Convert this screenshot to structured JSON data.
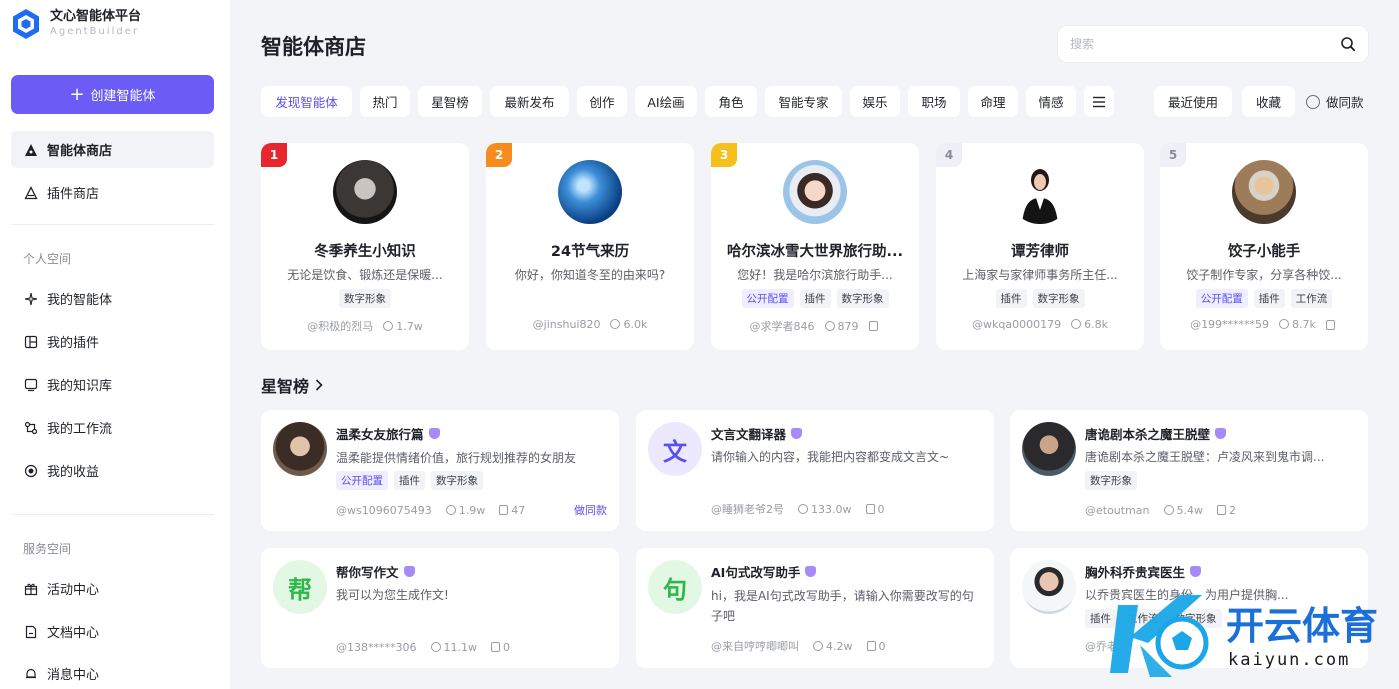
{
  "brand": {
    "title": "文心智能体平台",
    "subtitle": "AgentBuilder"
  },
  "sidebar": {
    "create_label": "创建智能体",
    "main_items": [
      {
        "label": "智能体商店",
        "icon": "agent-store-icon"
      },
      {
        "label": "插件商店",
        "icon": "plugin-store-icon"
      }
    ],
    "personal_title": "个人空间",
    "personal_items": [
      {
        "label": "我的智能体",
        "icon": "sparkle-icon"
      },
      {
        "label": "我的插件",
        "icon": "plugin-icon"
      },
      {
        "label": "我的知识库",
        "icon": "knowledge-icon"
      },
      {
        "label": "我的工作流",
        "icon": "workflow-icon"
      },
      {
        "label": "我的收益",
        "icon": "revenue-icon"
      }
    ],
    "service_title": "服务空间",
    "service_items": [
      {
        "label": "活动中心",
        "icon": "gift-icon"
      },
      {
        "label": "文档中心",
        "icon": "document-icon"
      },
      {
        "label": "消息中心",
        "icon": "bell-icon"
      }
    ]
  },
  "header": {
    "title": "智能体商店",
    "search_placeholder": "搜索"
  },
  "tabs": [
    "发现智能体",
    "热门",
    "星智榜",
    "最新发布",
    "创作",
    "AI绘画",
    "角色",
    "智能专家",
    "娱乐",
    "职场",
    "命理",
    "情感"
  ],
  "right_tabs": {
    "recent": "最近使用",
    "favorites": "收藏",
    "same_style": "做同款"
  },
  "top_cards": [
    {
      "rank": "1",
      "rank_color": "#e8262d",
      "name": "冬季养生小知识",
      "desc": "无论是饮食、锻炼还是保暖...",
      "tags": [
        "数字形象"
      ],
      "author": "@积极的烈马",
      "uses": "1.7w",
      "copy": ""
    },
    {
      "rank": "2",
      "rank_color": "#f58d1e",
      "name": "24节气来历",
      "desc": "你好，你知道冬至的由来吗?",
      "tags": [],
      "author": "@jinshui820",
      "uses": "6.0k",
      "copy": ""
    },
    {
      "rank": "3",
      "rank_color": "#f5c01e",
      "name": "哈尔滨冰雪大世界旅行助...",
      "desc": "您好！我是哈尔滨旅行助手...",
      "tags": [
        "公开配置",
        "插件",
        "数字形象"
      ],
      "author": "@求学者846",
      "uses": "879",
      "copy": " "
    },
    {
      "rank": "4",
      "rank_color": "",
      "name": "谭芳律师",
      "desc": "上海家与家律师事务所主任...",
      "tags": [
        "插件",
        "数字形象"
      ],
      "author": "@wkqa0000179",
      "uses": "6.8k",
      "copy": ""
    },
    {
      "rank": "5",
      "rank_color": "",
      "name": "饺子小能手",
      "desc": "饺子制作专家，分享各种饺...",
      "tags": [
        "公开配置",
        "插件",
        "工作流"
      ],
      "author": "@199******59",
      "uses": "8.7k",
      "copy": " "
    }
  ],
  "star_section_title": "星智榜",
  "list_cards": [
    {
      "name": "温柔女友旅行篇",
      "desc": "温柔能提供情绪价值，旅行规划推荐的女朋友",
      "tags": [
        "公开配置",
        "插件",
        "数字形象"
      ],
      "author": "@ws1096075493",
      "uses": "1.9w",
      "copies": "47",
      "same": "做同款",
      "avatar_char": ""
    },
    {
      "name": "文言文翻译器",
      "desc": "请你输入的内容，我能把内容都变成文言文~",
      "tags": [],
      "author": "@睡狮老爷2号",
      "uses": "133.0w",
      "copies": "0",
      "same": "",
      "avatar_char": "文"
    },
    {
      "name": "唐诡剧本杀之魔王脱壁",
      "desc": "唐诡剧本杀之魔王脱壁：卢凌风来到鬼市调...",
      "tags": [
        "数字形象"
      ],
      "author": "@etoutman",
      "uses": "5.4w",
      "copies": "2",
      "same": "",
      "avatar_char": ""
    },
    {
      "name": "帮你写作文",
      "desc": "我可以为您生成作文!",
      "tags": [],
      "author": "@138*****306",
      "uses": "11.1w",
      "copies": "0",
      "same": "",
      "avatar_char": "帮"
    },
    {
      "name": "AI句式改写助手",
      "desc": "hi，我是AI句式改写助手，请输入你需要改写的句子吧",
      "tags": [],
      "author": "@来自哼哼唧唧叫",
      "uses": "4.2w",
      "copies": "0",
      "same": "",
      "avatar_char": "句"
    },
    {
      "name": "胸外科乔贵宾医生",
      "desc": "以乔贵宾医生的身份，为用户提供胸...",
      "tags": [
        "插件",
        "工作流",
        "数字形象"
      ],
      "author": "@乔老",
      "uses": "",
      "copies": "",
      "same": "",
      "avatar_char": ""
    }
  ],
  "watermark": {
    "brand": "开云体育",
    "url": "kaiyun.com"
  },
  "colors": {
    "accent": "#6a5cf5",
    "accent_text": "#5b4ff0"
  }
}
